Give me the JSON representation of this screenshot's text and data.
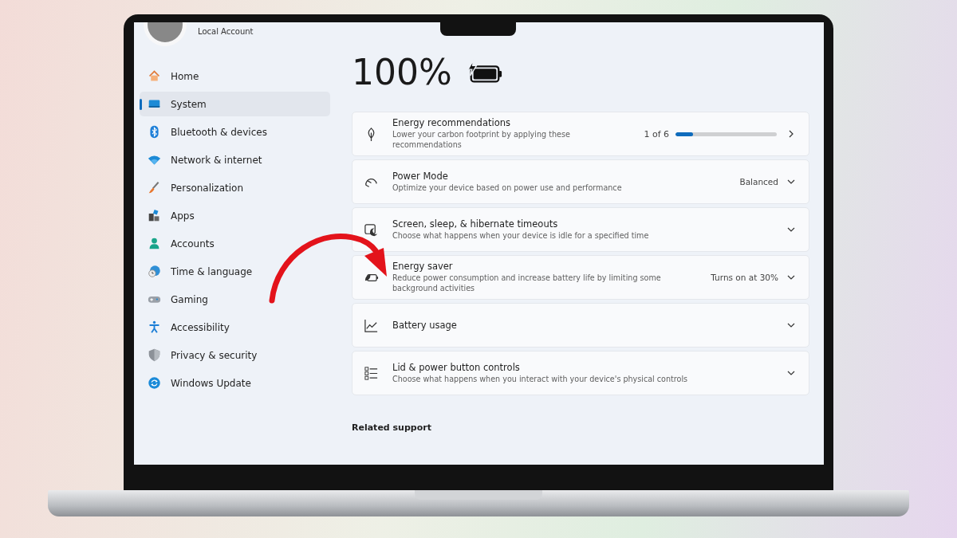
{
  "account": {
    "type": "Local Account"
  },
  "sidebar": {
    "items": [
      {
        "label": "Home",
        "selected": false
      },
      {
        "label": "System",
        "selected": true
      },
      {
        "label": "Bluetooth & devices",
        "selected": false
      },
      {
        "label": "Network & internet",
        "selected": false
      },
      {
        "label": "Personalization",
        "selected": false
      },
      {
        "label": "Apps",
        "selected": false
      },
      {
        "label": "Accounts",
        "selected": false
      },
      {
        "label": "Time & language",
        "selected": false
      },
      {
        "label": "Gaming",
        "selected": false
      },
      {
        "label": "Accessibility",
        "selected": false
      },
      {
        "label": "Privacy & security",
        "selected": false
      },
      {
        "label": "Windows Update",
        "selected": false
      }
    ]
  },
  "battery": {
    "percent": "100%",
    "charging": true
  },
  "cards": [
    {
      "kind": "link",
      "title": "Energy recommendations",
      "description": "Lower your carbon footprint by applying these recommendations",
      "progress": {
        "text": "1 of 6",
        "level": 0.17
      }
    },
    {
      "kind": "expander",
      "title": "Power Mode",
      "description": "Optimize your device based on power use and performance",
      "value": "Balanced"
    },
    {
      "kind": "expander",
      "title": "Screen, sleep, & hibernate timeouts",
      "description": "Choose what happens when your device is idle for a specified time"
    },
    {
      "kind": "expander",
      "title": "Energy saver",
      "description": "Reduce power consumption and increase battery life by limiting some background activities",
      "value": "Turns on at 30%"
    },
    {
      "kind": "expander",
      "title": "Battery usage"
    },
    {
      "kind": "expander",
      "title": "Lid & power button controls",
      "description": "Choose what happens when you interact with your device's physical controls"
    }
  ],
  "related_support": {
    "heading": "Related support"
  }
}
